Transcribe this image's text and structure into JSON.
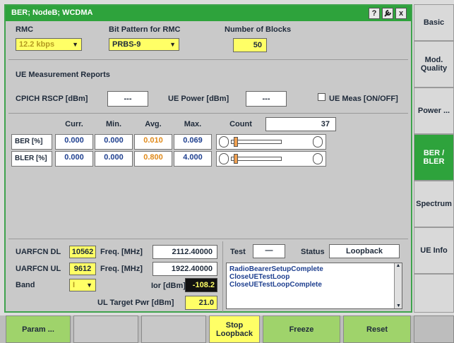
{
  "window": {
    "title": "BER; NodeB; WCDMA",
    "help_icon": "?",
    "tool_icon": "wrench",
    "close_icon": "x"
  },
  "top": {
    "rmc_label": "RMC",
    "rmc_value": "12.2 kbps",
    "bit_pattern_label": "Bit Pattern for RMC",
    "bit_pattern_value": "PRBS-9",
    "blocks_label": "Number of Blocks",
    "blocks_value": "50"
  },
  "ue_reports": {
    "heading": "UE Measurement Reports",
    "cpich_label": "CPICH RSCP [dBm]",
    "cpich_value": "---",
    "ue_power_label": "UE Power [dBm]",
    "ue_power_value": "---",
    "ue_meas_label": "UE Meas [ON/OFF]"
  },
  "results": {
    "headers": [
      "Curr.",
      "Min.",
      "Avg.",
      "Max.",
      "Count"
    ],
    "count": "37",
    "rows": [
      {
        "label": "BER  [%]",
        "curr": "0.000",
        "min": "0.000",
        "avg": "0.010",
        "max": "0.069"
      },
      {
        "label": "BLER  [%]",
        "curr": "0.000",
        "min": "0.000",
        "avg": "0.800",
        "max": "4.000"
      }
    ]
  },
  "config": {
    "uarfcn_dl_label": "UARFCN DL",
    "uarfcn_dl": "10562",
    "uarfcn_ul_label": "UARFCN UL",
    "uarfcn_ul": "9612",
    "band_label": "Band",
    "band_value": "I",
    "freq_label": "Freq. [MHz]",
    "freq_dl": "2112.40000",
    "freq_ul": "1922.40000",
    "ior_label": "Ior [dBm]",
    "ior_value": "-108.2",
    "ul_target_label": "UL Target Pwr [dBm]",
    "ul_target_value": "21.0"
  },
  "status": {
    "test_label": "Test",
    "test_value": "—",
    "status_label": "Status",
    "status_value": "Loopback",
    "log": [
      "RadioBearerSetupComplete",
      "CloseUETestLoop",
      "CloseUETestLoopComplete"
    ]
  },
  "sidebar": [
    {
      "label": "Basic"
    },
    {
      "label": "Mod. Quality"
    },
    {
      "label": "Power ..."
    },
    {
      "label": "BER / BLER"
    },
    {
      "label": "Spectrum"
    },
    {
      "label": "UE Info"
    }
  ],
  "bottom": {
    "param": "Param ...",
    "stop": "Stop Loopback",
    "freeze": "Freeze",
    "reset": "Reset"
  },
  "colors": {
    "accent": "#2ea33c",
    "field": "#ffff66",
    "value_blue": "#1e3f8f",
    "value_orange": "#e08a1a"
  }
}
